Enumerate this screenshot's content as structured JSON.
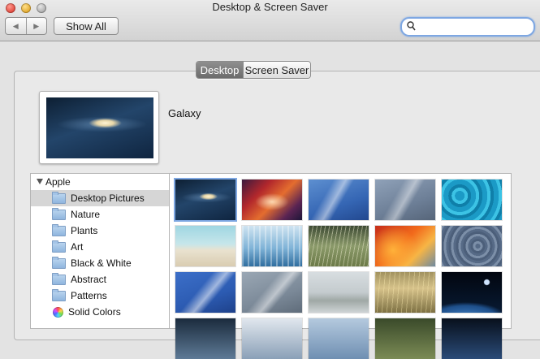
{
  "window": {
    "title": "Desktop & Screen Saver",
    "buttons": {
      "close": "close-button",
      "minimize": "minimize-button",
      "zoom": "zoom-button"
    }
  },
  "toolbar": {
    "back_glyph": "◀",
    "forward_glyph": "▶",
    "show_all_label": "Show All",
    "search": {
      "value": "",
      "placeholder": ""
    }
  },
  "tabs": [
    {
      "label": "Desktop",
      "active": true
    },
    {
      "label": "Screen Saver",
      "active": false
    }
  ],
  "current_picture": {
    "name": "Galaxy"
  },
  "sidebar": {
    "group_label": "Apple",
    "items": [
      {
        "label": "Desktop Pictures",
        "icon": "folder-icon",
        "selected": true
      },
      {
        "label": "Nature",
        "icon": "folder-icon",
        "selected": false
      },
      {
        "label": "Plants",
        "icon": "folder-icon",
        "selected": false
      },
      {
        "label": "Art",
        "icon": "folder-icon",
        "selected": false
      },
      {
        "label": "Black & White",
        "icon": "folder-icon",
        "selected": false
      },
      {
        "label": "Abstract",
        "icon": "folder-icon",
        "selected": false
      },
      {
        "label": "Patterns",
        "icon": "folder-icon",
        "selected": false
      },
      {
        "label": "Solid Colors",
        "icon": "color-wheel-icon",
        "selected": false
      }
    ]
  },
  "thumbnails": [
    {
      "name": "galaxy",
      "selected": true
    },
    {
      "name": "antelope-canyon",
      "selected": false
    },
    {
      "name": "blue-wave",
      "selected": false
    },
    {
      "name": "gray-wave",
      "selected": false
    },
    {
      "name": "water-ripples",
      "selected": false
    },
    {
      "name": "beach",
      "selected": false
    },
    {
      "name": "frozen-trees",
      "selected": false
    },
    {
      "name": "grass",
      "selected": false
    },
    {
      "name": "autumn-leaves",
      "selected": false
    },
    {
      "name": "ripple-gray",
      "selected": false
    },
    {
      "name": "blue-swirl",
      "selected": false
    },
    {
      "name": "gray-swirl",
      "selected": false
    },
    {
      "name": "foggy-lake",
      "selected": false
    },
    {
      "name": "golden-field",
      "selected": false
    },
    {
      "name": "earth-horizon",
      "selected": false
    }
  ],
  "colors": {
    "focus_ring": "#7ea7e2",
    "selected_row": "#d6d6d6",
    "active_tab": "#7d7d7d"
  }
}
